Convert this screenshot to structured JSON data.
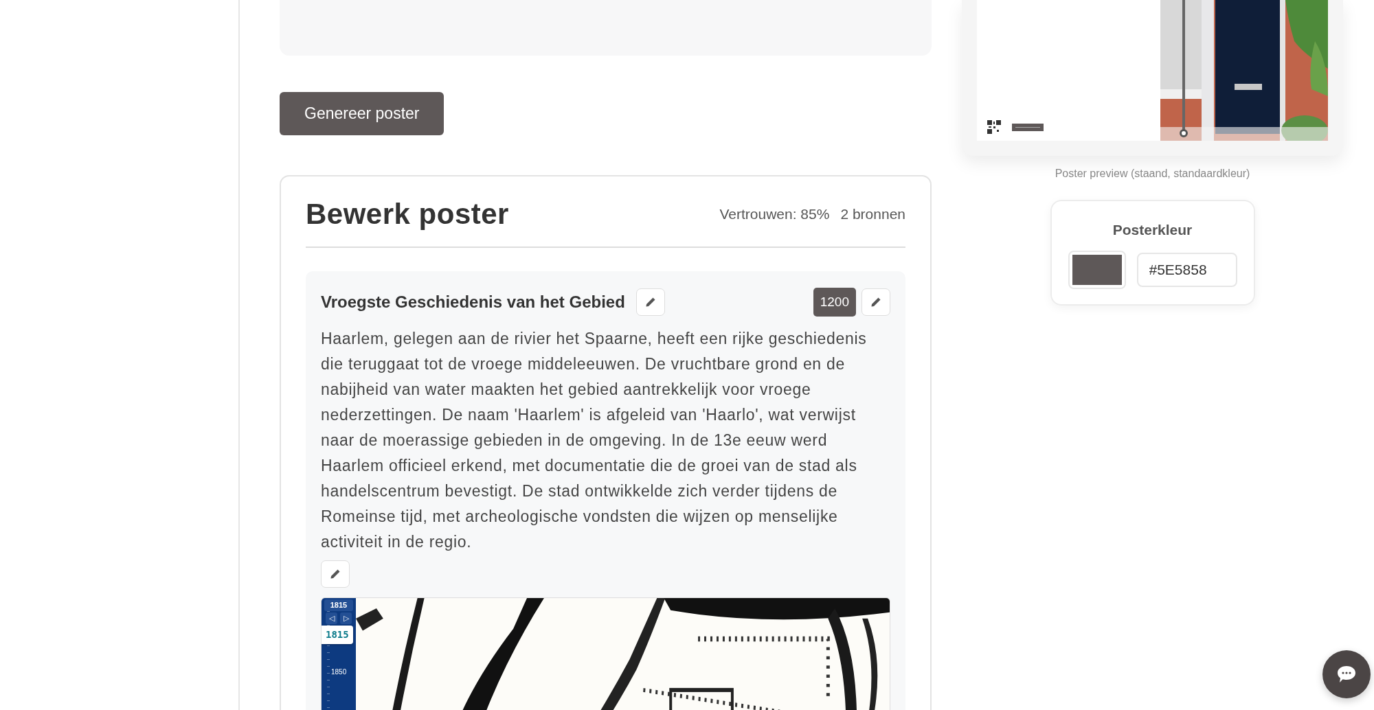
{
  "generate_button": "Genereer poster",
  "editor": {
    "title": "Bewerk poster",
    "confidence": "Vertrouwen: 85%",
    "sources": "2 bronnen",
    "sections": [
      {
        "title": "Vroegste Geschiedenis van het Gebied",
        "year": "1200",
        "text": "Haarlem, gelegen aan de rivier het Spaarne, heeft een rijke geschiedenis die teruggaat tot de vroege middeleeuwen. De vruchtbare grond en de nabijheid van water maakten het gebied aantrekkelijk voor vroege nederzettingen. De naam 'Haarlem' is afgeleid van 'Haarlo', wat verwijst naar de moerassige gebieden in de omgeving. In de 13e eeuw werd Haarlem officieel erkend, met documentatie die de groei van de stad als handelscentrum bevestigt. De stad ontwikkelde zich verder tijdens de Romeinse tijd, met archeologische vondsten die wijzen op menselijke activiteit in de regio.",
        "map": {
          "kind": "picture",
          "timeline": {
            "year_select": "1815",
            "prev": "◁",
            "next": "▷",
            "year_stepper": "1815",
            "tick_label": "1850"
          }
        }
      }
    ]
  },
  "preview": {
    "caption": "Poster preview (staand, standaardkleur)"
  },
  "poster_color": {
    "label": "Posterkleur",
    "value": "#5E5858"
  }
}
